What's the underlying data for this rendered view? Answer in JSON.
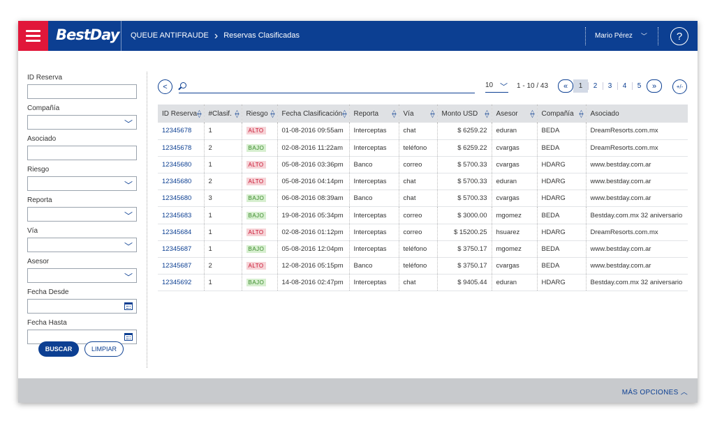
{
  "header": {
    "logo": "BestDay",
    "breadcrumb": [
      "QUEUE ANTIFRAUDE",
      "Reservas Clasificadas"
    ],
    "user": "Mario Pérez",
    "help": "?"
  },
  "sidebar": {
    "fields": [
      {
        "label": "ID Reserva",
        "type": "text"
      },
      {
        "label": "Compañía",
        "type": "select"
      },
      {
        "label": "Asociado",
        "type": "text"
      },
      {
        "label": "Riesgo",
        "type": "select"
      },
      {
        "label": "Reporta",
        "type": "select"
      },
      {
        "label": "Vía",
        "type": "select"
      },
      {
        "label": "Asesor",
        "type": "select"
      },
      {
        "label": "Fecha Desde",
        "type": "date"
      },
      {
        "label": "Fecha Hasta",
        "type": "date"
      }
    ],
    "search_label": "BUSCAR",
    "clear_label": "LIMPIAR"
  },
  "toolbar": {
    "back": "<",
    "per_page": "10",
    "range": "1 - 10 / 43",
    "first": "«",
    "last": "»",
    "pages": [
      "1",
      "2",
      "3",
      "4",
      "5"
    ],
    "active_page": "1",
    "plusminus": "+/-"
  },
  "table": {
    "columns": [
      "ID Reserva",
      "#Clasif.",
      "Riesgo",
      "Fecha Clasificación",
      "Reporta",
      "Vía",
      "Monto USD",
      "Asesor",
      "Compañía",
      "Asociado"
    ],
    "rows": [
      [
        "12345678",
        "1",
        "ALTO",
        "01-08-2016 09:55am",
        "Interceptas",
        "chat",
        "$ 6259.22",
        "eduran",
        "BEDA",
        "DreamResorts.com.mx"
      ],
      [
        "12345678",
        "2",
        "BAJO",
        "02-08-2016 11:22am",
        "Interceptas",
        "teléfono",
        "$ 6259.22",
        "cvargas",
        "BEDA",
        "DreamResorts.com.mx"
      ],
      [
        "12345680",
        "1",
        "ALTO",
        "05-08-2016 03:36pm",
        "Banco",
        "correo",
        "$ 5700.33",
        "cvargas",
        "HDARG",
        "www.bestday.com.ar"
      ],
      [
        "12345680",
        "2",
        "ALTO",
        "05-08-2016 04:14pm",
        "Interceptas",
        "chat",
        "$ 5700.33",
        "eduran",
        "HDARG",
        "www.bestday.com.ar"
      ],
      [
        "12345680",
        "3",
        "BAJO",
        "06-08-2016 08:39am",
        "Banco",
        "chat",
        "$ 5700.33",
        "cvargas",
        "HDARG",
        "www.bestday.com.ar"
      ],
      [
        "12345683",
        "1",
        "BAJO",
        "19-08-2016 05:34pm",
        "Interceptas",
        "correo",
        "$ 3000.00",
        "mgomez",
        "BEDA",
        "Bestday.com.mx 32 aniversario"
      ],
      [
        "12345684",
        "1",
        "ALTO",
        "02-08-2016 01:12pm",
        "Interceptas",
        "correo",
        "$ 15200.25",
        "hsuarez",
        "HDARG",
        "DreamResorts.com.mx"
      ],
      [
        "12345687",
        "1",
        "BAJO",
        "05-08-2016 12:04pm",
        "Interceptas",
        "teléfono",
        "$ 3750.17",
        "mgomez",
        "BEDA",
        "www.bestday.com.ar"
      ],
      [
        "12345687",
        "2",
        "ALTO",
        "12-08-2016 05:15pm",
        "Banco",
        "teléfono",
        "$ 3750.17",
        "cvargas",
        "BEDA",
        "www.bestday.com.ar"
      ],
      [
        "12345692",
        "1",
        "BAJO",
        "14-08-2016 02:47pm",
        "Interceptas",
        "chat",
        "$ 9405.44",
        "eduran",
        "HDARG",
        "Bestday.com.mx 32 aniversario"
      ]
    ]
  },
  "footer": {
    "more_options": "MÁS OPCIONES"
  },
  "colors": {
    "brand_blue": "#0c3f92",
    "menu_red": "#e1173a",
    "risk_high": "#c8102e",
    "risk_low": "#3a8a2a"
  }
}
